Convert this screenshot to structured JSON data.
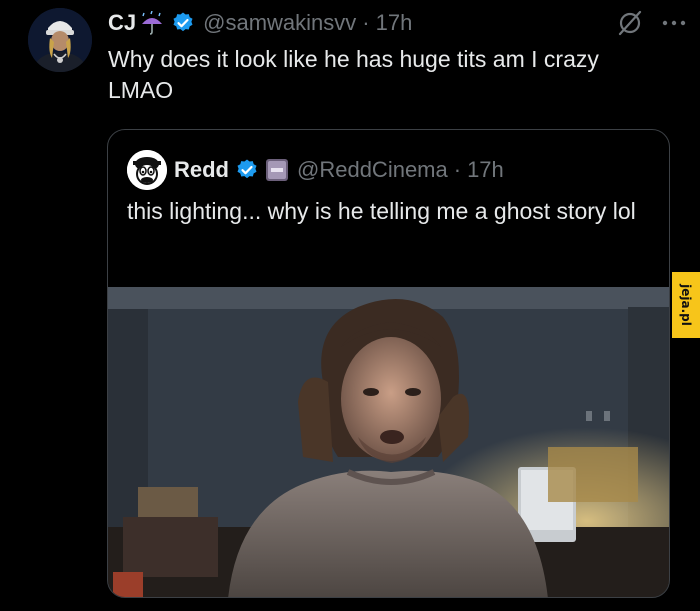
{
  "tweet": {
    "author_name": "CJ",
    "emoji": "umbrella-rain-icon",
    "handle": "@samwakinsvv",
    "separator": "·",
    "time": "17h",
    "text": "Why does it look like he has huge tits am I crazy LMAO"
  },
  "quote": {
    "author_name": "Redd",
    "handle": "@ReddCinema",
    "separator": "·",
    "time": "17h",
    "text": "this lighting... why is he telling me a ghost story lol",
    "media": "video-frame"
  },
  "watermark": {
    "text": "jeja.pl"
  },
  "colors": {
    "background": "#000000",
    "text": "#e7e9ea",
    "muted": "#71767b",
    "verified": "#1d9bf0",
    "border": "#3c4045",
    "watermark": "#f7c51a"
  }
}
